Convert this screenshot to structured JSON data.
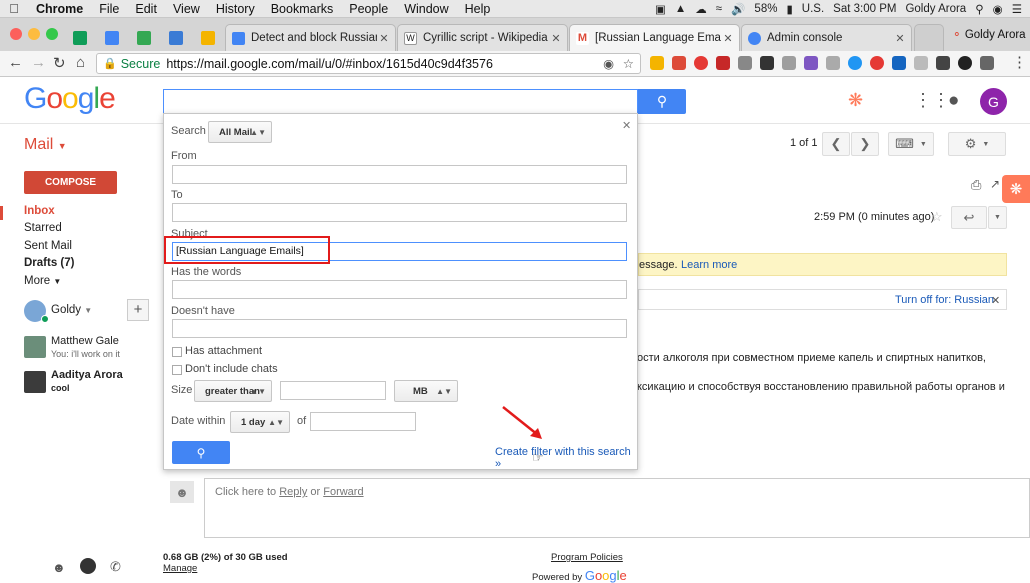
{
  "menubar": {
    "app": "Chrome",
    "items": [
      "File",
      "Edit",
      "View",
      "History",
      "Bookmarks",
      "People",
      "Window",
      "Help"
    ],
    "battery": "58%",
    "input_source": "U.S.",
    "clock": "Sat 3:00 PM",
    "user": "Goldy Arora"
  },
  "tabs": [
    {
      "title": "Detect and block Russian la"
    },
    {
      "title": "Cyrillic script - Wikipedia"
    },
    {
      "title": "[Russian Language Emails] "
    },
    {
      "title": "Admin console"
    }
  ],
  "profile_name": "Goldy Arora",
  "address": {
    "secure_label": "Secure",
    "url": "https://mail.google.com/mail/u/0/#inbox/1615d40c9d4f3576"
  },
  "header": {
    "logo_letters": [
      "G",
      "o",
      "o",
      "g",
      "l",
      "e"
    ],
    "avatar_initial": "G"
  },
  "nav": {
    "mail_label": "Mail",
    "compose": "COMPOSE",
    "inbox": "Inbox",
    "starred": "Starred",
    "sent": "Sent Mail",
    "drafts": "Drafts (7)",
    "more": "More"
  },
  "contacts": {
    "self": "Goldy",
    "list": [
      {
        "name": "Matthew Gale",
        "sub": "You: i'll work on it"
      },
      {
        "name": "Aaditya Arora",
        "sub": "cool"
      }
    ]
  },
  "toolbar": {
    "pagination": "1 of 1"
  },
  "message": {
    "time": "2:59 PM (0 minutes ago)",
    "notice": "essage.",
    "learn_more": "Learn more",
    "turn_off": "Turn off for: Russian",
    "line1": "ости алкоголя при совместном приеме капель и спиртных напитков,",
    "line2": "ксикацию и способствуя восстановлению правильной работы органов и"
  },
  "reply": {
    "prefix": "Click here to",
    "reply": "Reply",
    "or": "or",
    "forward": "Forward"
  },
  "footer": {
    "storage": "0.68 GB (2%) of 30 GB used",
    "manage": "Manage",
    "policies": "Program Policies",
    "powered": "Powered by"
  },
  "search_panel": {
    "search_label": "Search",
    "search_scope": "All Mail",
    "from_label": "From",
    "to_label": "To",
    "subject_label": "Subject",
    "subject_value": "[Russian Language Emails]",
    "has_words_label": "Has the words",
    "doesnt_have_label": "Doesn't have",
    "has_attachment": "Has attachment",
    "no_chats": "Don't include chats",
    "size_label": "Size",
    "size_op": "greater than",
    "size_unit": "MB",
    "date_label": "Date within",
    "date_value": "1 day",
    "of_label": "of",
    "create_filter": "Create filter with this search »"
  },
  "colors": {
    "gmail_red": "#dd4b39",
    "compose": "#d14836",
    "google_blue": "#4285f4",
    "annotation_red": "#e21b1b",
    "link": "#1a5ab8"
  }
}
